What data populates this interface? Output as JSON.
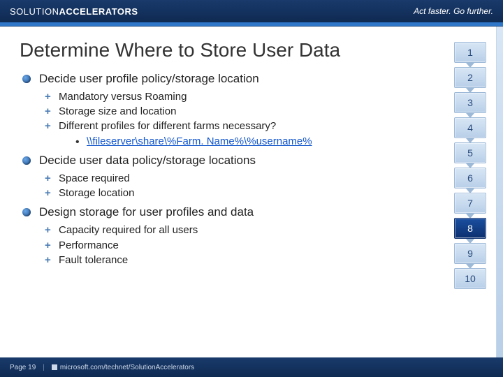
{
  "header": {
    "brand_prefix": "SOLUTION",
    "brand_bold": "ACCELERATORS",
    "tagline": "Act faster. Go further."
  },
  "title": "Determine Where to Store User Data",
  "bullets": {
    "b1": "Decide user profile policy/storage location",
    "b1_1": "Mandatory versus Roaming",
    "b1_2": "Storage size and location",
    "b1_3": "Different profiles for different farms necessary?",
    "b1_3_1": "\\\\fileserver\\share\\%Farm. Name%\\%username%",
    "b2": "Decide user data policy/storage locations",
    "b2_1": "Space required",
    "b2_2": "Storage location",
    "b3": "Design storage for user profiles and data",
    "b3_1": "Capacity required for all users",
    "b3_2": "Performance",
    "b3_3": "Fault tolerance"
  },
  "steps": {
    "s1": "1",
    "s2": "2",
    "s3": "3",
    "s4": "4",
    "s5": "5",
    "s6": "6",
    "s7": "7",
    "s8": "8",
    "s9": "9",
    "s10": "10",
    "active": 8
  },
  "footer": {
    "page": "Page 19",
    "sep": "|",
    "url": "microsoft.com/technet/SolutionAccelerators"
  }
}
